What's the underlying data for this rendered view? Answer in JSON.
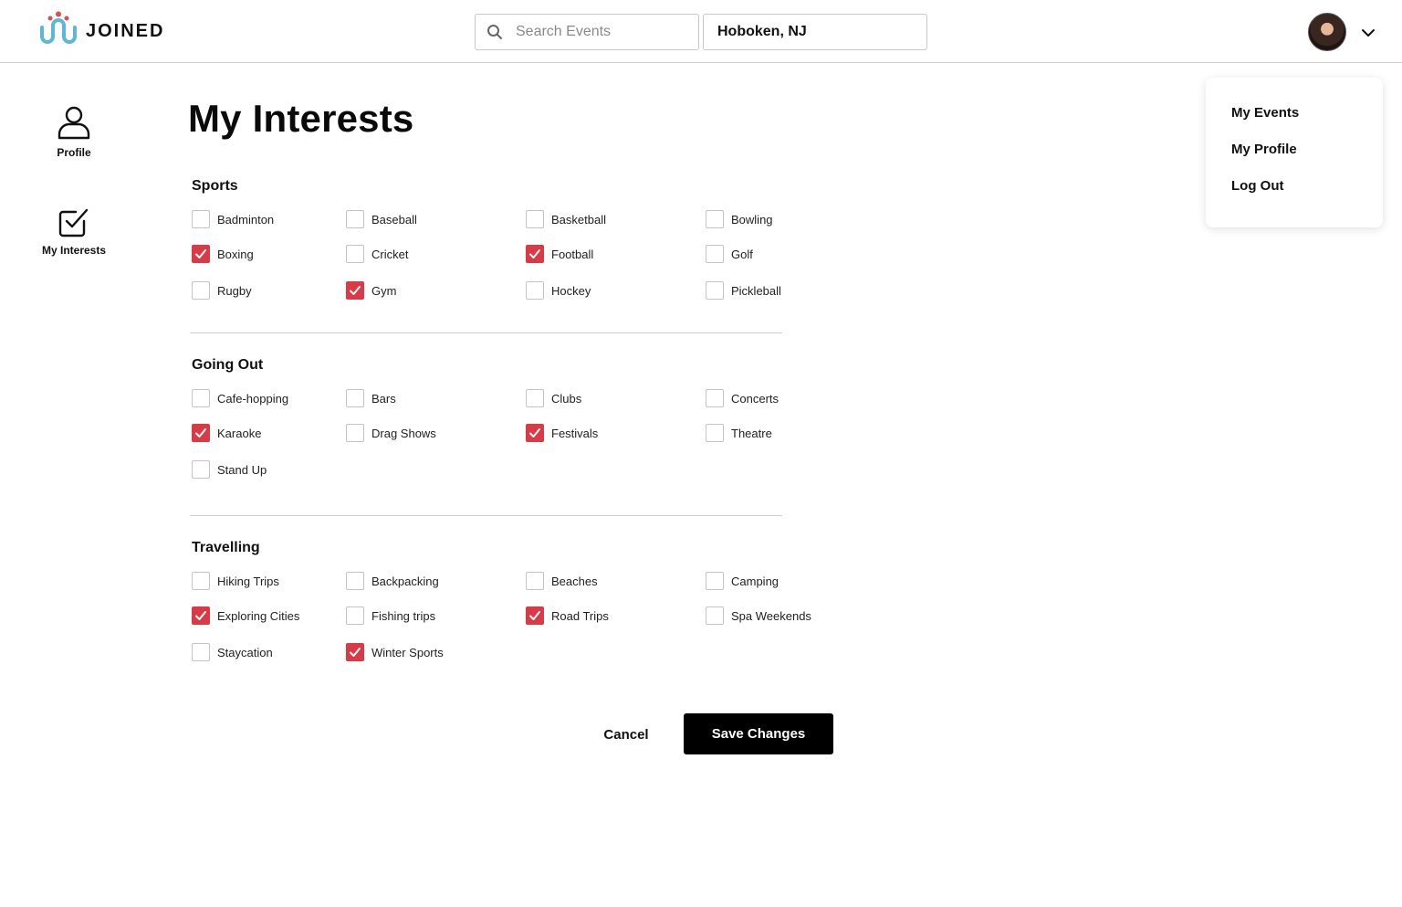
{
  "brand": {
    "name": "JOINED"
  },
  "header": {
    "search_placeholder": "Search Events",
    "location_value": "Hoboken, NJ"
  },
  "nav": {
    "profile_label": "Profile",
    "interests_label": "My Interests"
  },
  "page_title": "My Interests",
  "colors": {
    "accent": "#d93a45",
    "logo_blue": "#5bb8d6",
    "logo_red": "#e04c55"
  },
  "sections": [
    {
      "title": "Sports",
      "options": [
        {
          "label": "Badminton",
          "checked": false
        },
        {
          "label": "Baseball",
          "checked": false
        },
        {
          "label": "Basketball",
          "checked": false
        },
        {
          "label": "Bowling",
          "checked": false
        },
        {
          "label": "Boxing",
          "checked": true
        },
        {
          "label": "Cricket",
          "checked": false
        },
        {
          "label": "Football",
          "checked": true
        },
        {
          "label": "Golf",
          "checked": false
        },
        {
          "label": "Rugby",
          "checked": false
        },
        {
          "label": "Gym",
          "checked": true
        },
        {
          "label": "Hockey",
          "checked": false
        },
        {
          "label": "Pickleball",
          "checked": false
        }
      ]
    },
    {
      "title": "Going Out",
      "options": [
        {
          "label": "Cafe-hopping",
          "checked": false
        },
        {
          "label": "Bars",
          "checked": false
        },
        {
          "label": "Clubs",
          "checked": false
        },
        {
          "label": "Concerts",
          "checked": false
        },
        {
          "label": "Karaoke",
          "checked": true
        },
        {
          "label": "Drag Shows",
          "checked": false
        },
        {
          "label": "Festivals",
          "checked": true
        },
        {
          "label": "Theatre",
          "checked": false
        },
        {
          "label": "Stand Up",
          "checked": false
        }
      ]
    },
    {
      "title": "Travelling",
      "options": [
        {
          "label": "Hiking Trips",
          "checked": false
        },
        {
          "label": "Backpacking",
          "checked": false
        },
        {
          "label": "Beaches",
          "checked": false
        },
        {
          "label": "Camping",
          "checked": false
        },
        {
          "label": "Exploring Cities",
          "checked": true
        },
        {
          "label": "Fishing trips",
          "checked": false
        },
        {
          "label": "Road Trips",
          "checked": true
        },
        {
          "label": "Spa Weekends",
          "checked": false
        },
        {
          "label": "Staycation",
          "checked": false
        },
        {
          "label": "Winter Sports",
          "checked": true
        }
      ]
    }
  ],
  "actions": {
    "cancel_label": "Cancel",
    "save_label": "Save Changes"
  },
  "dropdown": {
    "items": [
      "My Events",
      "My Profile",
      "Log Out"
    ]
  }
}
